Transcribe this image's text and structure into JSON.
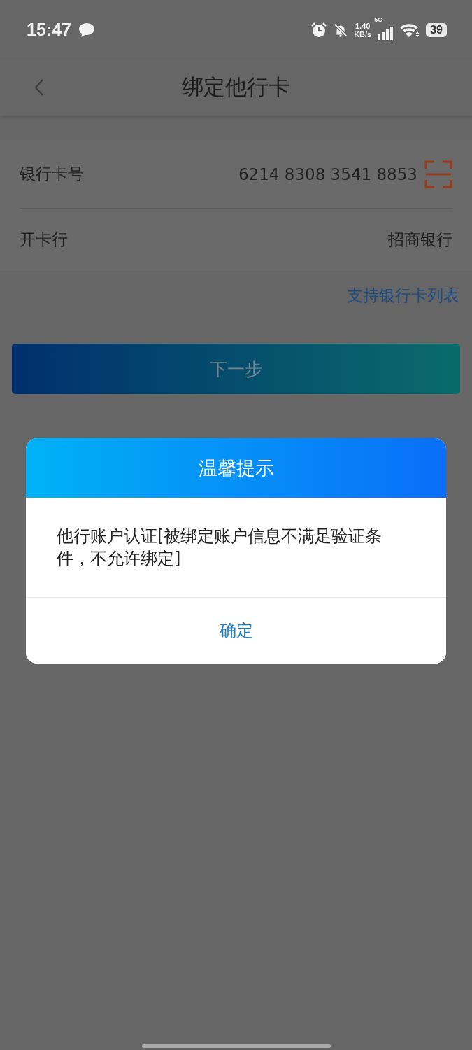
{
  "status_bar": {
    "time": "15:47",
    "speed_value": "1.40",
    "speed_unit": "KB/s",
    "network": "5G",
    "battery": "39"
  },
  "header": {
    "title": "绑定他行卡"
  },
  "fields": [
    {
      "label": "银行卡号",
      "value": "6214 8308 3541 8853",
      "kind": "scan"
    },
    {
      "label": "开卡行",
      "value": "招商银行",
      "kind": "plain"
    }
  ],
  "link": "支持银行卡列表",
  "next_button": "下一步",
  "dialog": {
    "title": "温馨提示",
    "message": "他行账户认证[被绑定账户信息不满足验证条件，不允许绑定]",
    "button": "确定"
  }
}
